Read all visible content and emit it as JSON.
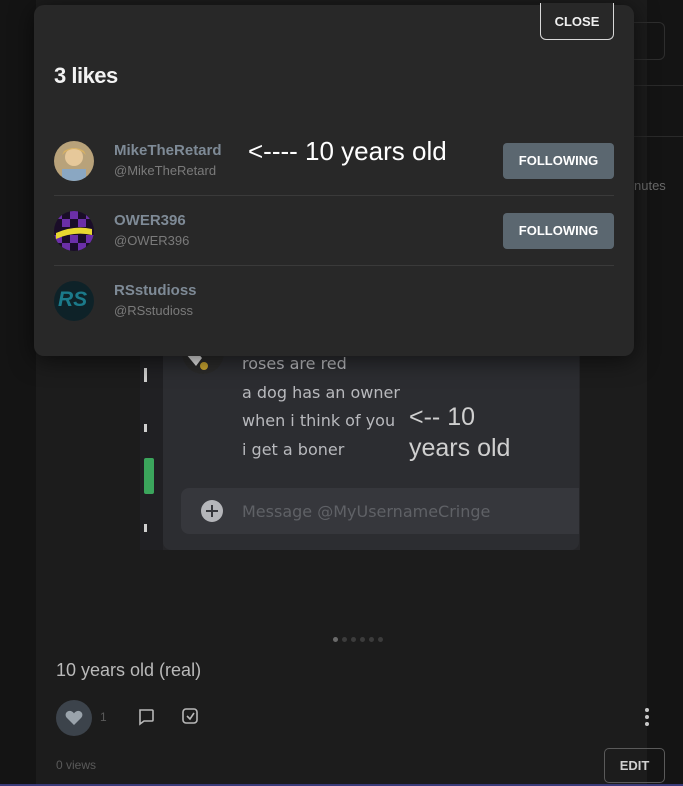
{
  "background": {
    "minutes_fragment": "nutes",
    "poem_lines": [
      "roses are red",
      "a dog has an owner",
      "when i think of you",
      "i get a boner"
    ],
    "inner_annotation": "<-- 10 years old",
    "message_placeholder": "Message @MyUsernameCringe",
    "post_title": "10 years old (real)",
    "like_count": "1",
    "views": "0 views",
    "edit_label": "EDIT"
  },
  "modal": {
    "title": "3 likes",
    "close_label": "CLOSE",
    "annotation": "<---- 10 years old",
    "users": [
      {
        "name": "MikeTheRetard",
        "handle": "@MikeTheRetard",
        "follow_label": "FOLLOWING"
      },
      {
        "name": "OWER396",
        "handle": "@OWER396",
        "follow_label": "FOLLOWING"
      },
      {
        "name": "RSstudioss",
        "handle": "@RSstudioss",
        "avatar_text": "RS"
      }
    ]
  },
  "colors": {
    "button": "#5b6770",
    "modal_bg": "#282828",
    "page_bg": "#141414",
    "green_accent": "#3ba55c"
  }
}
